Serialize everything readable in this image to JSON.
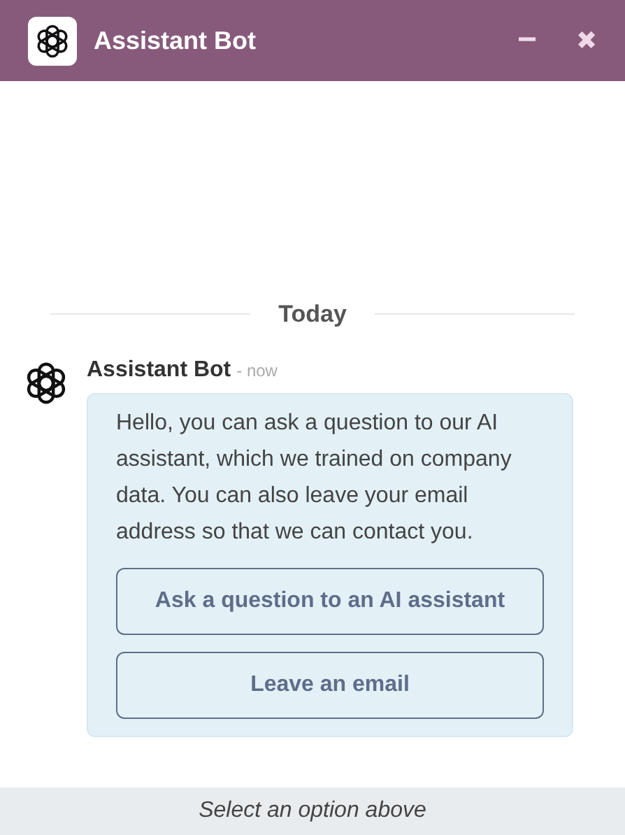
{
  "window": {
    "title": "Assistant Bot",
    "minimize": "−",
    "close": "✖"
  },
  "divider": "Today",
  "messages": [
    {
      "author": "Assistant Bot",
      "time": "- now",
      "text": "Hello, you can ask a question to our AI assistant, which we trained on company data. You can also leave your email address so that we can contact you.",
      "options": [
        "Ask a question to an AI assistant",
        "Leave an email"
      ]
    }
  ],
  "footer": "Select an option above"
}
